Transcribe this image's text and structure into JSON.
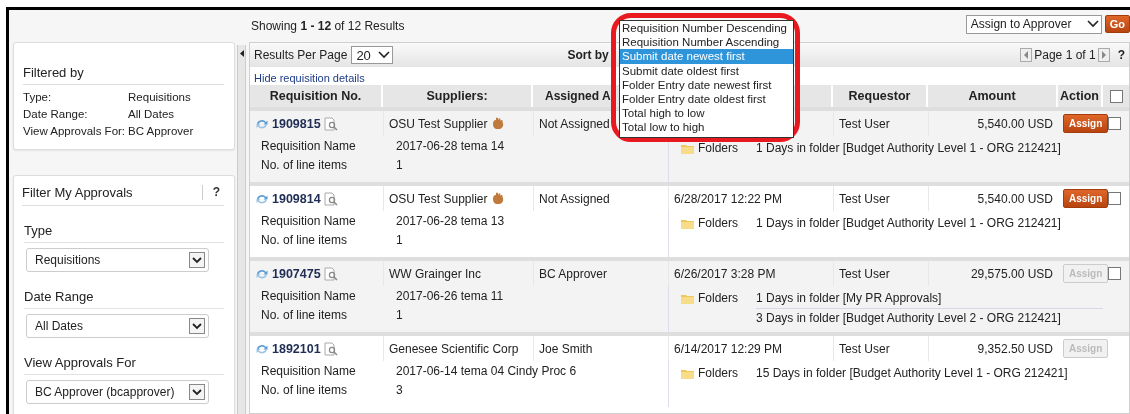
{
  "results_summary": "Showing **1 - 12** of 12 Results",
  "bulk_action": {
    "value": "Assign to Approver",
    "go": "Go"
  },
  "sidebar": {
    "filtered_by": {
      "title": "Filtered by",
      "items": [
        {
          "label": "Type:",
          "value": "Requisitions"
        },
        {
          "label": "Date Range:",
          "value": "All Dates"
        },
        {
          "label": "View Approvals For:",
          "value": "BC Approver"
        }
      ]
    },
    "filter_panel": {
      "title": "Filter My Approvals",
      "help": "?",
      "fields": [
        {
          "label": "Type",
          "value": "Requisitions"
        },
        {
          "label": "Date Range",
          "value": "All Dates"
        },
        {
          "label": "View Approvals For",
          "value": "BC Approver (bcapprover)"
        }
      ]
    }
  },
  "toolbar": {
    "per_page_label": "Results Per Page",
    "per_page": "20",
    "sort_label": "Sort by",
    "page_info": "Page 1 of 1",
    "help": "?"
  },
  "sort_menu": {
    "options": [
      {
        "label": "Requisition Number Descending",
        "selected": false
      },
      {
        "label": "Requisition Number Ascending",
        "selected": false
      },
      {
        "label": "Submit date newest first",
        "selected": true
      },
      {
        "label": "Submit date oldest first",
        "selected": false
      },
      {
        "label": "Folder Entry date newest first",
        "selected": false
      },
      {
        "label": "Folder Entry date oldest first",
        "selected": false
      },
      {
        "label": "Total high to low",
        "selected": false
      },
      {
        "label": "Total low to high",
        "selected": false
      }
    ]
  },
  "details_link": "Hide requisition details",
  "table": {
    "columns": [
      "Requisition No.",
      "Suppliers:",
      "Assigned A",
      "Requestor",
      "Amount",
      "Action"
    ],
    "select_all": {
      "checked": false
    },
    "rows": [
      {
        "number": "1909815",
        "supplier": "OSU Test Supplier",
        "supplier_badge": true,
        "assigned": "Not Assigned",
        "requestor": "Test User",
        "amount": "5,540.00 USD",
        "action": "Assign",
        "action_disabled": false,
        "checked": false,
        "name_label": "Requisition Name",
        "name": "2017-06-28 tema 14",
        "items_label": "No. of line items",
        "items": "1",
        "folders_label": "Folders",
        "folders": [
          "1 Days in folder [Budget Authority Level 1 - ORG 212421]"
        ]
      },
      {
        "number": "1909814",
        "supplier": "OSU Test Supplier",
        "supplier_badge": true,
        "assigned": "Not Assigned",
        "date": "6/28/2017 12:22 PM",
        "requestor": "Test User",
        "amount": "5,540.00 USD",
        "action": "Assign",
        "action_disabled": false,
        "checked": false,
        "name_label": "Requisition Name",
        "name": "2017-06-28 tema 13",
        "items_label": "No. of line items",
        "items": "1",
        "folders_label": "Folders",
        "folders": [
          "1 Days in folder [Budget Authority Level 1 - ORG 212421]"
        ]
      },
      {
        "number": "1907475",
        "supplier": "WW Grainger Inc",
        "supplier_badge": false,
        "assigned": "BC Approver",
        "date": "6/26/2017 3:28 PM",
        "requestor": "Test User",
        "amount": "29,575.00 USD",
        "action": "Assign",
        "action_disabled": true,
        "checked": false,
        "name_label": "Requisition Name",
        "name": "2017-06-26 tema 11",
        "items_label": "No. of line items",
        "items": "1",
        "folders_label": "Folders",
        "folders": [
          "1 Days in folder [My PR Approvals]",
          "3 Days in folder [Budget Authority Level 2 - ORG 212421]"
        ]
      },
      {
        "number": "1892101",
        "supplier": "Genesee Scientific Corp",
        "supplier_badge": false,
        "assigned": "Joe Smith",
        "date": "6/14/2017 12:29 PM",
        "requestor": "Test User",
        "amount": "9,352.50 USD",
        "action": "Assign",
        "action_disabled": true,
        "name_label": "Requisition Name",
        "name": "2017-06-14 tema 04 Cindy Proc 6",
        "items_label": "No. of line items",
        "items": "3",
        "folders_label": "Folders",
        "folders": [
          "15 Days in folder [Budget Authority Level 1 - ORG 212421]"
        ]
      }
    ]
  }
}
